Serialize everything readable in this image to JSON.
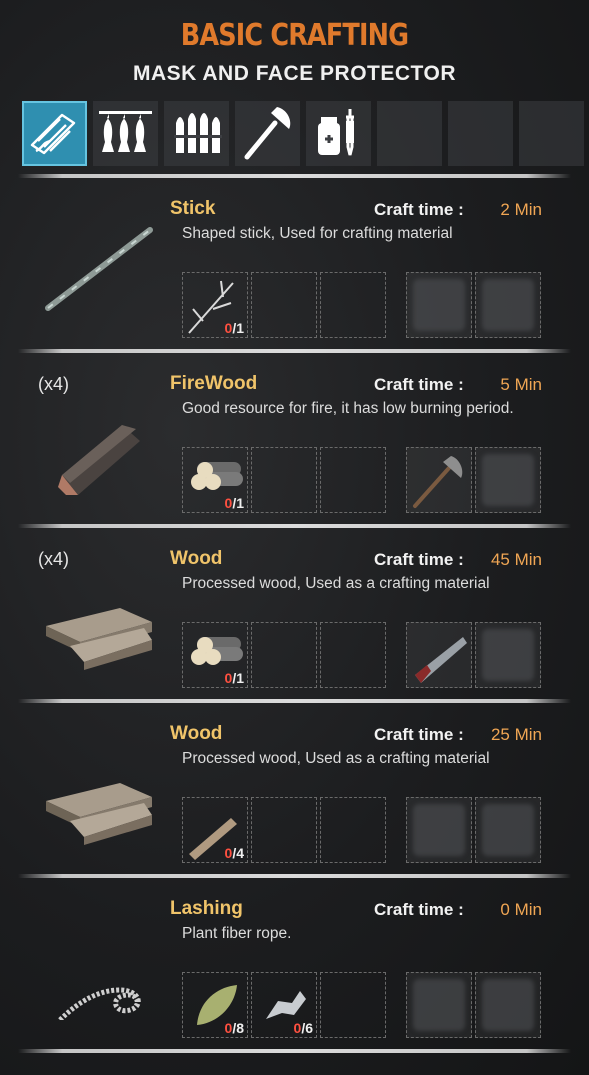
{
  "header": {
    "title": "BASIC CRAFTING",
    "subtitle": "MASK AND FACE PROTECTOR"
  },
  "tabs": [
    {
      "icon": "wood-planks-icon",
      "active": true
    },
    {
      "icon": "hanging-fish-icon",
      "active": false
    },
    {
      "icon": "bullets-icon",
      "active": false
    },
    {
      "icon": "axe-icon",
      "active": false
    },
    {
      "icon": "medkit-syringe-icon",
      "active": false
    },
    {
      "icon": "empty",
      "active": false
    },
    {
      "icon": "empty",
      "active": false
    },
    {
      "icon": "empty",
      "active": false
    }
  ],
  "craft_time_label": "Craft time :",
  "recipes": [
    {
      "qty": "",
      "name": "Stick",
      "time": "2 Min",
      "desc": "Shaped stick, Used for crafting material",
      "item_icon": "stick-icon",
      "ingredients": [
        {
          "icon": "twig-icon",
          "have": "0",
          "need": "1"
        }
      ],
      "tools": []
    },
    {
      "qty": "(x4)",
      "name": "FireWood",
      "time": "5 Min",
      "desc": "Good resource for fire, it has low burning period.",
      "item_icon": "firewood-icon",
      "ingredients": [
        {
          "icon": "logs-icon",
          "have": "0",
          "need": "1"
        }
      ],
      "tools": [
        "hatchet-icon"
      ]
    },
    {
      "qty": "(x4)",
      "name": "Wood",
      "time": "45 Min",
      "desc": "Processed wood, Used as a crafting material",
      "item_icon": "planks-icon",
      "ingredients": [
        {
          "icon": "logs-icon",
          "have": "0",
          "need": "1"
        }
      ],
      "tools": [
        "saw-icon"
      ]
    },
    {
      "qty": "",
      "name": "Wood",
      "time": "25 Min",
      "desc": "Processed wood, Used as a crafting material",
      "item_icon": "planks-icon",
      "ingredients": [
        {
          "icon": "plank-icon",
          "have": "0",
          "need": "4"
        }
      ],
      "tools": []
    },
    {
      "qty": "",
      "name": "Lashing",
      "time": "0 Min",
      "desc": "Plant fiber rope.",
      "item_icon": "rope-icon",
      "ingredients": [
        {
          "icon": "leaf-icon",
          "have": "0",
          "need": "8"
        },
        {
          "icon": "fiber-icon",
          "have": "0",
          "need": "6"
        }
      ],
      "tools": []
    }
  ]
}
